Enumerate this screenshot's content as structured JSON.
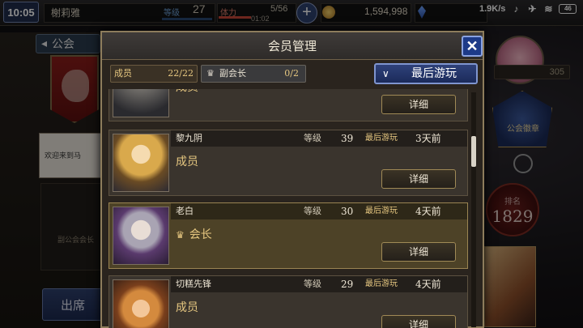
{
  "status_bar": {
    "time": "10:05",
    "network_speed": "1.9K/s",
    "battery": "46"
  },
  "player": {
    "name": "榭莉雅",
    "level_label": "等级",
    "level": "27",
    "stamina_label": "体力",
    "stamina": "5/56",
    "stamina_timer": "01:02",
    "gold": "1,594,998"
  },
  "background": {
    "guild_tab": "公会",
    "welcome_text": "欢迎来到马",
    "subtext": "副公会会长",
    "attend_button": "出席",
    "right_count": "305",
    "rank_label": "排名",
    "rank_value": "1829",
    "badge_text": "公会徽章"
  },
  "modal": {
    "title": "会员管理",
    "members_label": "成员",
    "members_count": "22/22",
    "vice_label": "副会长",
    "vice_count": "0/2",
    "sort_label": "最后游玩",
    "detail_label": "详细",
    "rows": [
      {
        "name": "",
        "role": "成员",
        "level": "",
        "last_seen": ""
      },
      {
        "name": "黎九阴",
        "role": "成员",
        "level": "39",
        "last_seen": "3天前"
      },
      {
        "name": "老白",
        "role": "会长",
        "level": "30",
        "last_seen": "4天前"
      },
      {
        "name": "切糕先锋",
        "role": "成员",
        "level": "29",
        "last_seen": "4天前"
      }
    ],
    "level_label": "等级",
    "last_played_label": "最后游玩"
  },
  "icons": {
    "close": "close-icon",
    "crown": "crown-icon",
    "chevron": "chevron-down-icon"
  },
  "colors": {
    "accent_blue": "#1d3a88",
    "gold_text": "#e6c780",
    "highlight_row": "#4d4227"
  }
}
